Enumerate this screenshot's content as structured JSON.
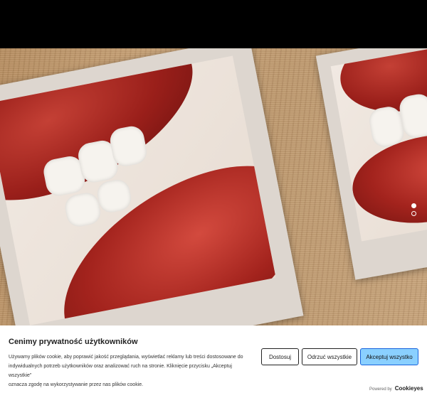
{
  "consent": {
    "title": "Cenimy prywatność użytkowników",
    "line1": "Używamy plików cookie, aby poprawić jakość przeglądania, wyświetlać reklamy lub treści dostosowane do",
    "line2": "indywidualnych potrzeb użytkowników oraz analizować ruch na stronie. Kliknięcie przycisku „Akceptuj wszystkie”",
    "line3": "oznacza zgodę na wykorzystywanie przez nas plików cookie.",
    "customize_label": "Dostosuj",
    "reject_label": "Odrzuć wszystkie",
    "accept_label": "Akceptuj wszystko",
    "powered_by": "Powered by",
    "brand": "Cookieyes"
  },
  "carousel": {
    "slide_count": 2,
    "active_slide": 1
  },
  "colors": {
    "accept_bg": "#8ad0ff",
    "accept_border": "#1863dc"
  }
}
